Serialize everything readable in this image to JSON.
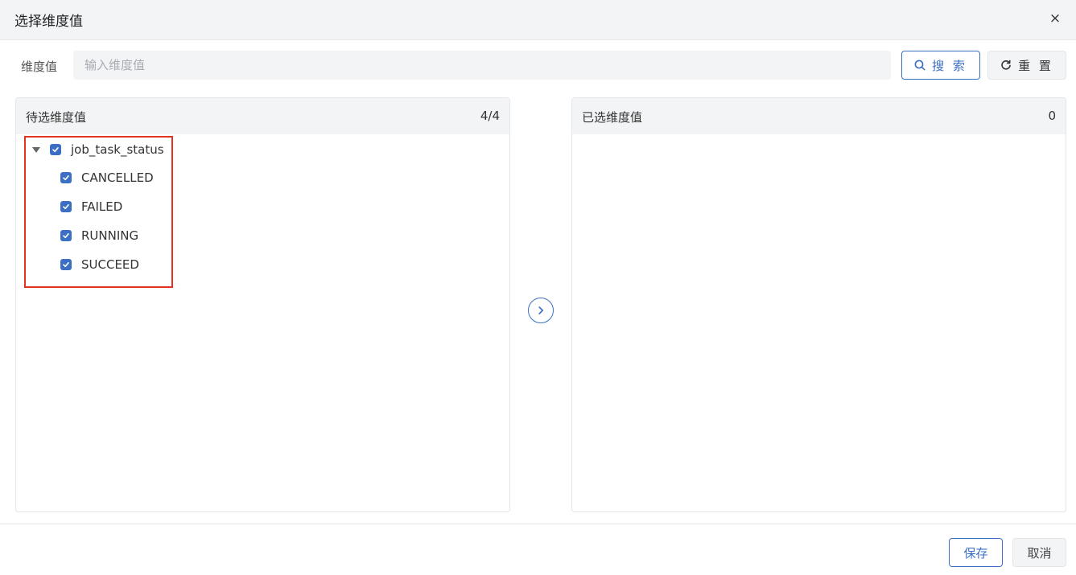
{
  "dialog": {
    "title": "选择维度值",
    "close_glyph": "×"
  },
  "search": {
    "label": "维度值",
    "placeholder": "输入维度值",
    "value": "",
    "search_button": "搜 索",
    "reset_button": "重 置"
  },
  "left_panel": {
    "title": "待选维度值",
    "count": "4/4",
    "tree": {
      "parent": {
        "label": "job_task_status",
        "checked": true,
        "expanded": true
      },
      "children": [
        {
          "label": "CANCELLED",
          "checked": true
        },
        {
          "label": "FAILED",
          "checked": true
        },
        {
          "label": "RUNNING",
          "checked": true
        },
        {
          "label": "SUCCEED",
          "checked": true
        }
      ]
    }
  },
  "right_panel": {
    "title": "已选维度值",
    "count": "0"
  },
  "footer": {
    "save_button": "保存",
    "cancel_button": "取消"
  },
  "colors": {
    "accent": "#3a6fc4",
    "highlight_border": "#e5311f",
    "header_bg": "#f3f4f6"
  },
  "icons": {
    "close": "close-icon",
    "search": "search-icon",
    "reset": "refresh-icon",
    "transfer": "chevron-right-icon",
    "caret": "caret-down-icon",
    "checkbox": "checkbox-checked-icon"
  }
}
